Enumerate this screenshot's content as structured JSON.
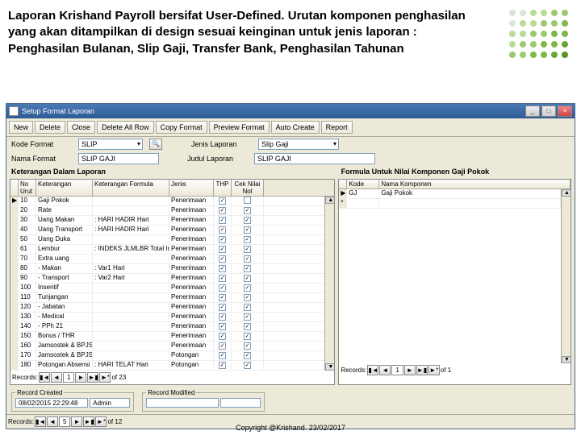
{
  "header": "Laporan Krishand Payroll bersifat User-Defined. Urutan komponen penghasilan yang akan ditampilkan di design sesuai keinginan untuk jenis laporan : Penghasilan Bulanan, Slip Gaji, Transfer Bank, Penghasilan Tahunan",
  "window": {
    "title": "Setup Format Laporan"
  },
  "toolbar": {
    "new": "New",
    "delete": "Delete",
    "close": "Close",
    "delete_all": "Delete All Row",
    "copy": "Copy Format",
    "preview": "Preview Format",
    "auto": "Auto Create",
    "report": "Report"
  },
  "form": {
    "kode_label": "Kode Format",
    "kode_value": "SLIP",
    "nama_label": "Nama Format",
    "nama_value": "SLIP GAJI",
    "jenis_label": "Jenis Laporan",
    "jenis_value": "Slip Gaji",
    "judul_label": "Judul Laporan",
    "judul_value": "SLIP GAJI"
  },
  "sections": {
    "left": "Keterangan Dalam Laporan",
    "right": "Formula Untuk Nilai Komponen Gaji Pokok"
  },
  "grid_left": {
    "cols": {
      "no": "No Urut",
      "ket": "Keterangan",
      "kf": "Keterangan Formula",
      "jn": "Jenis",
      "thp": "THP",
      "cnn": "Cek Nilai Nol"
    },
    "rows": [
      {
        "no": "10",
        "ket": "Gaji Pokok",
        "kf": "",
        "jn": "Penerimaan",
        "thp": true,
        "cnn": false
      },
      {
        "no": "20",
        "ket": "Rate",
        "kf": "",
        "jn": "Penerimaan",
        "thp": true,
        "cnn": true
      },
      {
        "no": "30",
        "ket": "Uang Makan",
        "kf": ": HARI HADIR Hari",
        "jn": "Penerimaan",
        "thp": true,
        "cnn": true
      },
      {
        "no": "40",
        "ket": "Uang Transport",
        "kf": ": HARI HADIR Hari",
        "jn": "Penerimaan",
        "thp": true,
        "cnn": true
      },
      {
        "no": "50",
        "ket": "Uang Duka",
        "kf": "",
        "jn": "Penerimaan",
        "thp": true,
        "cnn": true
      },
      {
        "no": "61",
        "ket": "Lembur",
        "kf": ": INDEKS JLMLBR Total Indeks",
        "jn": "Penerimaan",
        "thp": true,
        "cnn": true
      },
      {
        "no": "70",
        "ket": "Extra uang",
        "kf": "",
        "jn": "Penerimaan",
        "thp": true,
        "cnn": true
      },
      {
        "no": "80",
        "ket": " - Makan",
        "kf": ": Var1 Hari",
        "jn": "Penerimaan",
        "thp": true,
        "cnn": true
      },
      {
        "no": "90",
        "ket": " - Transport",
        "kf": ": Var2 Hari",
        "jn": "Penerimaan",
        "thp": true,
        "cnn": true
      },
      {
        "no": "100",
        "ket": "Insentif",
        "kf": "",
        "jn": "Penerimaan",
        "thp": true,
        "cnn": true
      },
      {
        "no": "110",
        "ket": "Tunjangan",
        "kf": "",
        "jn": "Penerimaan",
        "thp": true,
        "cnn": true
      },
      {
        "no": "120",
        "ket": " - Jabatan",
        "kf": "",
        "jn": "Penerimaan",
        "thp": true,
        "cnn": true
      },
      {
        "no": "130",
        "ket": " - Medical",
        "kf": "",
        "jn": "Penerimaan",
        "thp": true,
        "cnn": true
      },
      {
        "no": "140",
        "ket": " - PPh 21",
        "kf": "",
        "jn": "Penerimaan",
        "thp": true,
        "cnn": true
      },
      {
        "no": "150",
        "ket": "Bonus / THR",
        "kf": "",
        "jn": "Penerimaan",
        "thp": true,
        "cnn": true
      },
      {
        "no": "160",
        "ket": "Jamsostek & BPJS ( Company )",
        "kf": "",
        "jn": "Penerimaan",
        "thp": true,
        "cnn": true
      },
      {
        "no": "170",
        "ket": "Jamsostek & BPJS Ded ( Co )",
        "kf": "",
        "jn": "Potongan",
        "thp": true,
        "cnn": true
      },
      {
        "no": "180",
        "ket": "Potongan Absensi",
        "kf": ": HARI TELAT Hari",
        "jn": "Potongan",
        "thp": true,
        "cnn": true
      }
    ]
  },
  "grid_right": {
    "cols": {
      "kode": "Kode",
      "nama": "Nama Komponen"
    },
    "rows": [
      {
        "kode": "GJ",
        "nama": "Gaji Pokok"
      }
    ],
    "star": "*"
  },
  "nav": {
    "records_label": "Records:",
    "left_pos": "1",
    "left_of": "of  23",
    "right_pos": "1",
    "right_of": "of  1",
    "main_pos": "5",
    "main_of": "of  12"
  },
  "audit": {
    "created_legend": "Record Created",
    "created_date": "08/02/2015 22:29:48",
    "created_user": "Admin",
    "modified_legend": "Record Modified",
    "modified_date": "",
    "modified_user": ""
  },
  "copyright": "Copyright @Krishand. 23/02/2017"
}
